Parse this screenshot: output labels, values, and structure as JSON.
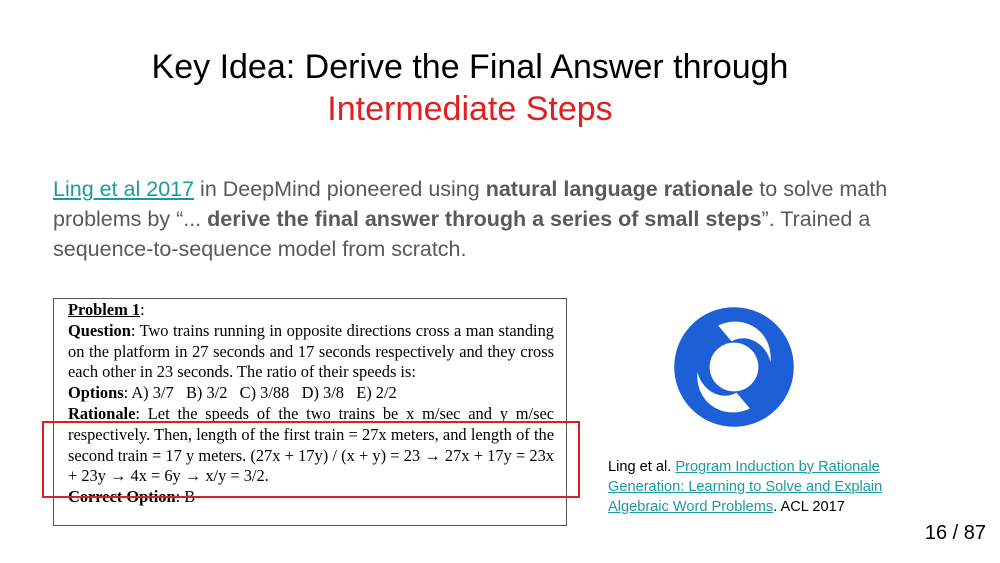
{
  "title": {
    "line1": "Key Idea: Derive the Final Answer through",
    "line2": "Intermediate Steps",
    "accent_color": "#e02020"
  },
  "body": {
    "link_text": "Ling et al 2017",
    "seg1": " in DeepMind pioneered using ",
    "bold1": "natural language rationale",
    "seg2": " to solve math problems by “... ",
    "bold2": "derive the final answer through a series of small steps",
    "seg3": "”. Trained a sequence-to-sequence model from scratch."
  },
  "problem": {
    "heading": "Problem 1",
    "heading_suffix": ":",
    "question_label": "Question",
    "question_text": ":  Two trains running in opposite directions cross a man standing on the platform in 27 seconds and 17 seconds respectively and they cross each other in 23 seconds. The ratio of their speeds is:",
    "options_label": "Options",
    "options_text": ": A) 3/7   B) 3/2   C) 3/88   D) 3/8   E) 2/2",
    "rationale_label": "Rationale",
    "rationale_text": ":  Let the speeds of the two trains be x m/sec and y m/sec respectively. Then, length of the first train = 27x meters, and length of the second train = 17 y meters. (27x + 17y) / (x + y) = 23 → 27x + 17y = 23x + 23y → 4x = 6y → x/y = 3/2.",
    "correct_label": "Correct Option",
    "correct_text": ": B"
  },
  "logo": {
    "icon": "deepmind-logo-icon",
    "color": "#1d5fd6"
  },
  "citation": {
    "prefix": "Ling et al. ",
    "link_text": "Program Induction by Rationale Generation: Learning to Solve and Explain Algebraic Word Problems",
    "suffix": ". ACL 2017"
  },
  "page": {
    "counter": "16 / 87"
  }
}
